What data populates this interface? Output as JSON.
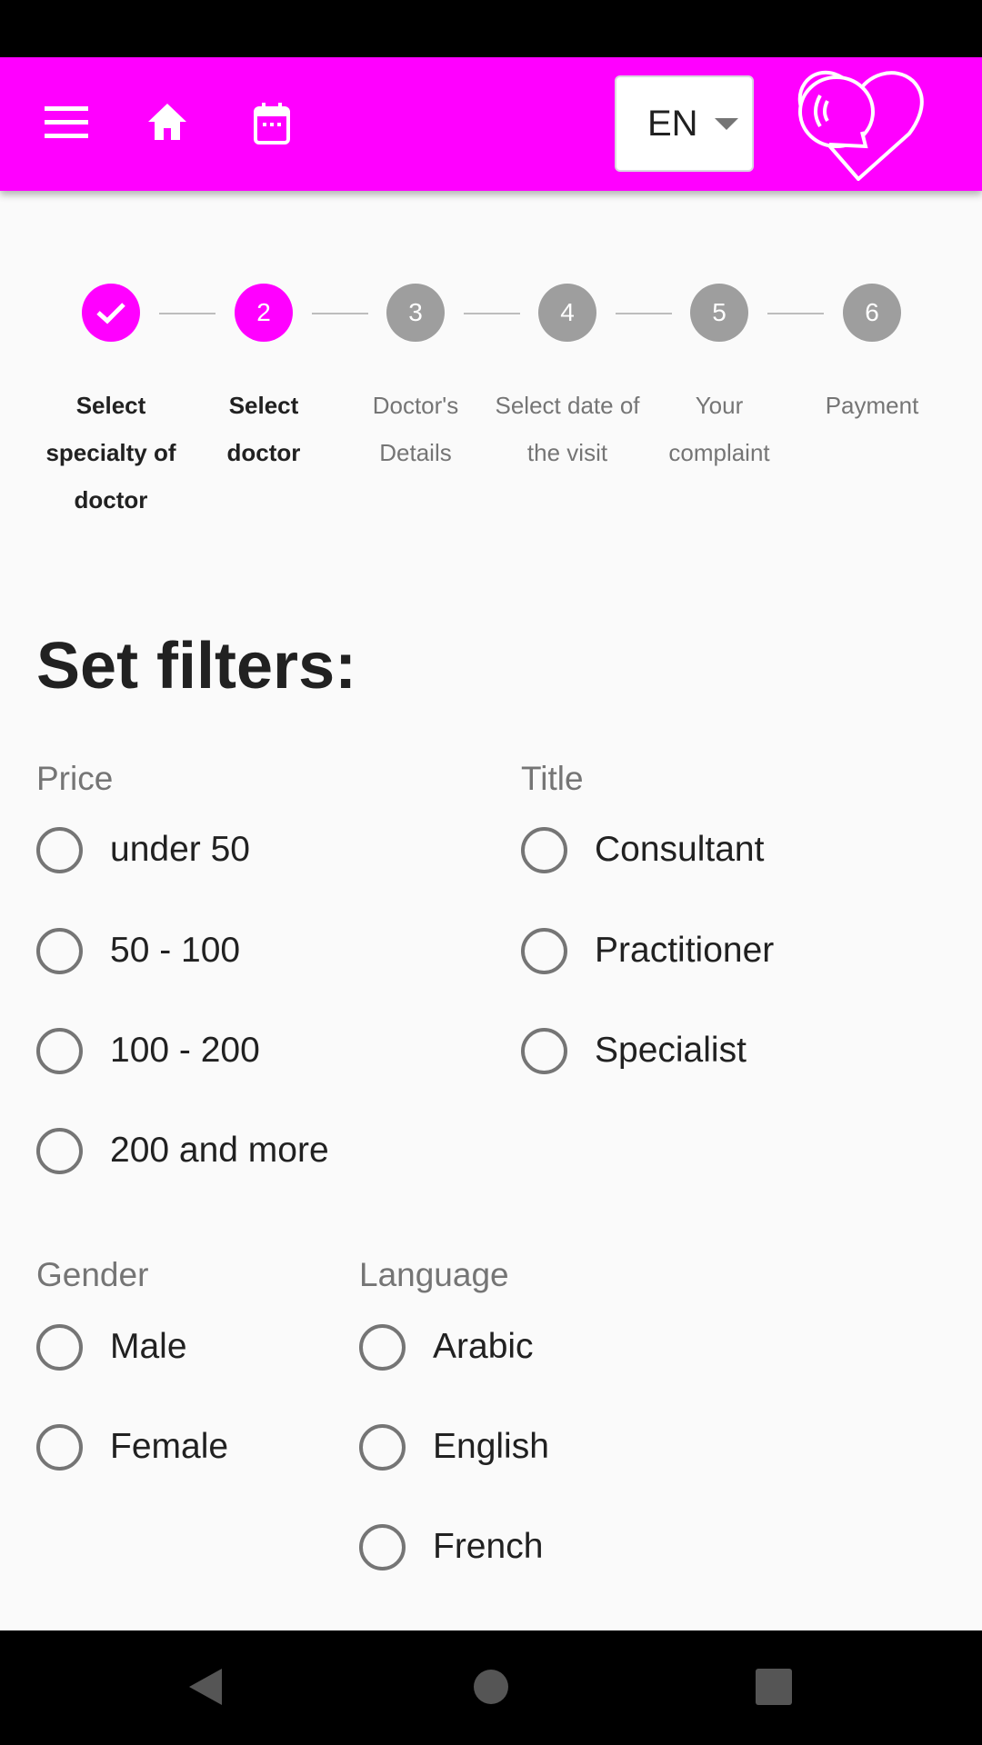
{
  "header": {
    "menu_icon": "hamburger-menu-icon",
    "home_icon": "home-icon",
    "calendar_icon": "calendar-icon",
    "language": "EN",
    "logo_icon": "heart-speech-logo",
    "accent": "#ff00ff"
  },
  "stepper": {
    "steps": [
      {
        "number": "",
        "label": "Select specialty of doctor",
        "state": "completed"
      },
      {
        "number": "2",
        "label": "Select doctor",
        "state": "active"
      },
      {
        "number": "3",
        "label": "Doctor's Details",
        "state": "inactive"
      },
      {
        "number": "4",
        "label": "Select date of the visit",
        "state": "inactive"
      },
      {
        "number": "5",
        "label": "Your complaint",
        "state": "inactive"
      },
      {
        "number": "6",
        "label": "Payment",
        "state": "inactive"
      }
    ]
  },
  "filters": {
    "title": "Set filters:",
    "price": {
      "label": "Price",
      "options": [
        "under 50",
        "50 - 100",
        "100 - 200",
        "200 and more"
      ]
    },
    "doctor_title": {
      "label": "Title",
      "options": [
        "Consultant",
        "Practitioner",
        "Specialist"
      ]
    },
    "gender": {
      "label": "Gender",
      "options": [
        "Male",
        "Female"
      ]
    },
    "language": {
      "label": "Language",
      "options": [
        "Arabic",
        "English",
        "French"
      ]
    }
  }
}
